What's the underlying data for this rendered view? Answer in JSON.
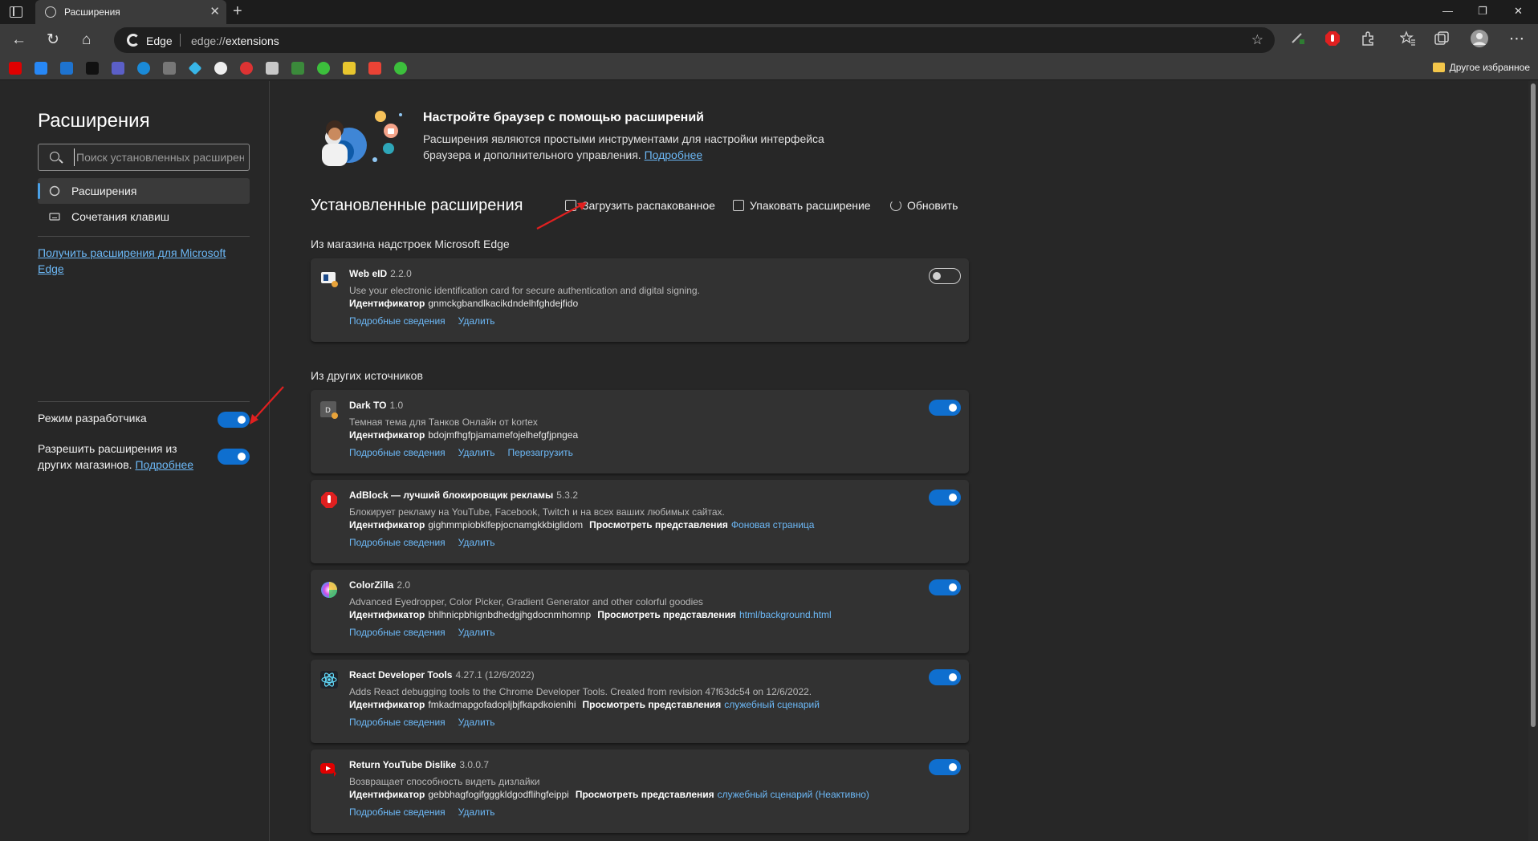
{
  "browser": {
    "tab_title": "Расширения",
    "address_label": "Edge",
    "url_prefix": "edge://",
    "url_path": "extensions",
    "other_favorites": "Другое избранное"
  },
  "sidebar": {
    "title": "Расширения",
    "search_placeholder": "Поиск установленных расширений",
    "items": [
      {
        "label": "Расширения"
      },
      {
        "label": "Сочетания клавиш"
      }
    ],
    "get_extensions_link": "Получить расширения для Microsoft Edge",
    "developer_mode_label": "Режим разработчика",
    "allow_other_stores_label": "Разрешить расширения из других магазинов.",
    "allow_other_stores_link": "Подробнее"
  },
  "hero": {
    "title": "Настройте браузер с помощью расширений",
    "description": "Расширения являются простыми инструментами для настройки интерфейса браузера и дополнительного управления.",
    "learn_more": "Подробнее"
  },
  "installed": {
    "title": "Установленные расширения",
    "load_unpacked": "Загрузить распакованное",
    "pack_extension": "Упаковать расширение",
    "update": "Обновить"
  },
  "sections": {
    "store": "Из магазина надстроек Microsoft Edge",
    "other": "Из других источников"
  },
  "labels": {
    "id": "Идентификатор",
    "views": "Просмотреть представления",
    "details": "Подробные сведения",
    "remove": "Удалить",
    "reload": "Перезагрузить"
  },
  "extensions": [
    {
      "name": "Web eID",
      "version": "2.2.0",
      "description": "Use your electronic identification card for secure authentication and digital signing.",
      "id": "gnmckgbandlkacikdndelhfghdejfido",
      "view": "",
      "enabled": false
    },
    {
      "name": "Dark TO",
      "version": "1.0",
      "description": "Темная тема для Танков Онлайн от kortex",
      "id": "bdojmfhgfpjamamefojelhefgfjpngea",
      "view": "",
      "enabled": true
    },
    {
      "name": "AdBlock — лучший блокировщик рекламы",
      "version": "5.3.2",
      "description": "Блокирует рекламу на YouTube, Facebook, Twitch и на всех ваших любимых сайтах.",
      "id": "gighmmpiobklfepjocnamgkkbiglidom",
      "view": "Фоновая страница",
      "enabled": true
    },
    {
      "name": "ColorZilla",
      "version": "2.0",
      "description": "Advanced Eyedropper, Color Picker, Gradient Generator and other colorful goodies",
      "id": "bhlhnicpbhignbdhedgjhgdocnmhomnp",
      "view": "html/background.html",
      "enabled": true
    },
    {
      "name": "React Developer Tools",
      "version": "4.27.1 (12/6/2022)",
      "description": "Adds React debugging tools to the Chrome Developer Tools. Created from revision 47f63dc54 on 12/6/2022.",
      "id": "fmkadmapgofadopljbjfkapdkoienihi",
      "view": "служебный сценарий",
      "enabled": true
    },
    {
      "name": "Return YouTube Dislike",
      "version": "3.0.0.7",
      "description": "Возвращает способность видеть дизлайки",
      "id": "gebbhagfogifgggkldgodflihgfeippi",
      "view": "служебный сценарий (Неактивно)",
      "enabled": true
    }
  ],
  "colors": {
    "accent": "#0f6fcf",
    "link": "#6cb8f6",
    "annotation_arrow": "#e02020"
  }
}
